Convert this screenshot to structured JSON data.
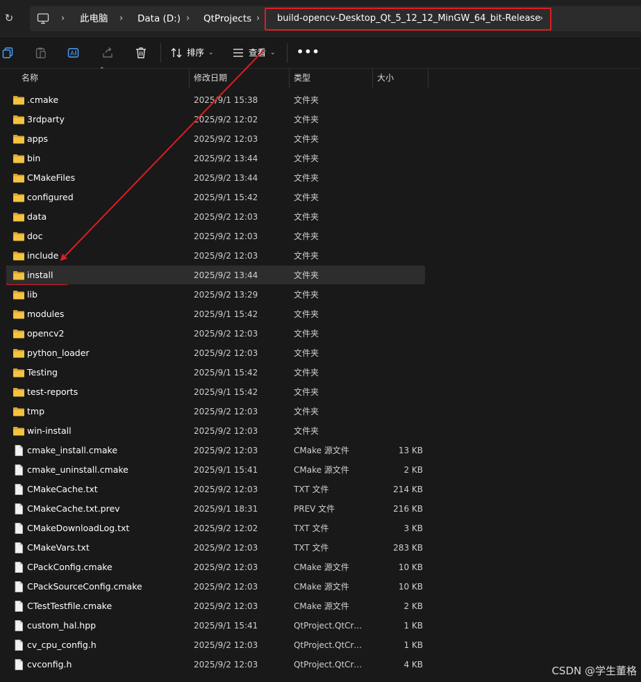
{
  "address_bar": {
    "breadcrumbs": [
      "此电脑",
      "Data (D:)",
      "QtProjects",
      "build-opencv-Desktop_Qt_5_12_12_MinGW_64_bit-Release"
    ]
  },
  "toolbar": {
    "sort_label": "排序",
    "view_label": "查看",
    "more_label": "•••"
  },
  "columns": {
    "name": "名称",
    "date": "修改日期",
    "type": "类型",
    "size": "大小"
  },
  "files": [
    {
      "name": ".cmake",
      "date": "2025/9/1 15:38",
      "type": "文件夹",
      "size": "",
      "kind": "folder"
    },
    {
      "name": "3rdparty",
      "date": "2025/9/2 12:02",
      "type": "文件夹",
      "size": "",
      "kind": "folder"
    },
    {
      "name": "apps",
      "date": "2025/9/2 12:03",
      "type": "文件夹",
      "size": "",
      "kind": "folder"
    },
    {
      "name": "bin",
      "date": "2025/9/2 13:44",
      "type": "文件夹",
      "size": "",
      "kind": "folder"
    },
    {
      "name": "CMakeFiles",
      "date": "2025/9/2 13:44",
      "type": "文件夹",
      "size": "",
      "kind": "folder"
    },
    {
      "name": "configured",
      "date": "2025/9/1 15:42",
      "type": "文件夹",
      "size": "",
      "kind": "folder"
    },
    {
      "name": "data",
      "date": "2025/9/2 12:03",
      "type": "文件夹",
      "size": "",
      "kind": "folder"
    },
    {
      "name": "doc",
      "date": "2025/9/2 12:03",
      "type": "文件夹",
      "size": "",
      "kind": "folder"
    },
    {
      "name": "include",
      "date": "2025/9/2 12:03",
      "type": "文件夹",
      "size": "",
      "kind": "folder"
    },
    {
      "name": "install",
      "date": "2025/9/2 13:44",
      "type": "文件夹",
      "size": "",
      "kind": "folder"
    },
    {
      "name": "lib",
      "date": "2025/9/2 13:29",
      "type": "文件夹",
      "size": "",
      "kind": "folder"
    },
    {
      "name": "modules",
      "date": "2025/9/1 15:42",
      "type": "文件夹",
      "size": "",
      "kind": "folder"
    },
    {
      "name": "opencv2",
      "date": "2025/9/2 12:03",
      "type": "文件夹",
      "size": "",
      "kind": "folder"
    },
    {
      "name": "python_loader",
      "date": "2025/9/2 12:03",
      "type": "文件夹",
      "size": "",
      "kind": "folder"
    },
    {
      "name": "Testing",
      "date": "2025/9/1 15:42",
      "type": "文件夹",
      "size": "",
      "kind": "folder"
    },
    {
      "name": "test-reports",
      "date": "2025/9/1 15:42",
      "type": "文件夹",
      "size": "",
      "kind": "folder"
    },
    {
      "name": "tmp",
      "date": "2025/9/2 12:03",
      "type": "文件夹",
      "size": "",
      "kind": "folder"
    },
    {
      "name": "win-install",
      "date": "2025/9/2 12:03",
      "type": "文件夹",
      "size": "",
      "kind": "folder"
    },
    {
      "name": "cmake_install.cmake",
      "date": "2025/9/2 12:03",
      "type": "CMake 源文件",
      "size": "13 KB",
      "kind": "file"
    },
    {
      "name": "cmake_uninstall.cmake",
      "date": "2025/9/1 15:41",
      "type": "CMake 源文件",
      "size": "2 KB",
      "kind": "file"
    },
    {
      "name": "CMakeCache.txt",
      "date": "2025/9/2 12:03",
      "type": "TXT 文件",
      "size": "214 KB",
      "kind": "file"
    },
    {
      "name": "CMakeCache.txt.prev",
      "date": "2025/9/1 18:31",
      "type": "PREV 文件",
      "size": "216 KB",
      "kind": "file"
    },
    {
      "name": "CMakeDownloadLog.txt",
      "date": "2025/9/2 12:02",
      "type": "TXT 文件",
      "size": "3 KB",
      "kind": "file"
    },
    {
      "name": "CMakeVars.txt",
      "date": "2025/9/2 12:03",
      "type": "TXT 文件",
      "size": "283 KB",
      "kind": "file"
    },
    {
      "name": "CPackConfig.cmake",
      "date": "2025/9/2 12:03",
      "type": "CMake 源文件",
      "size": "10 KB",
      "kind": "file"
    },
    {
      "name": "CPackSourceConfig.cmake",
      "date": "2025/9/2 12:03",
      "type": "CMake 源文件",
      "size": "10 KB",
      "kind": "file"
    },
    {
      "name": "CTestTestfile.cmake",
      "date": "2025/9/2 12:03",
      "type": "CMake 源文件",
      "size": "2 KB",
      "kind": "file"
    },
    {
      "name": "custom_hal.hpp",
      "date": "2025/9/1 15:41",
      "type": "QtProject.QtCre...",
      "size": "1 KB",
      "kind": "file"
    },
    {
      "name": "cv_cpu_config.h",
      "date": "2025/9/2 12:03",
      "type": "QtProject.QtCre...",
      "size": "1 KB",
      "kind": "file"
    },
    {
      "name": "cvconfig.h",
      "date": "2025/9/2 12:03",
      "type": "QtProject.QtCre...",
      "size": "4 KB",
      "kind": "file"
    }
  ],
  "selected_index": 9,
  "watermark": "CSDN @学生董格",
  "colors": {
    "annotation": "#e11b22",
    "folder": "#f4c33f",
    "background": "#191919"
  }
}
